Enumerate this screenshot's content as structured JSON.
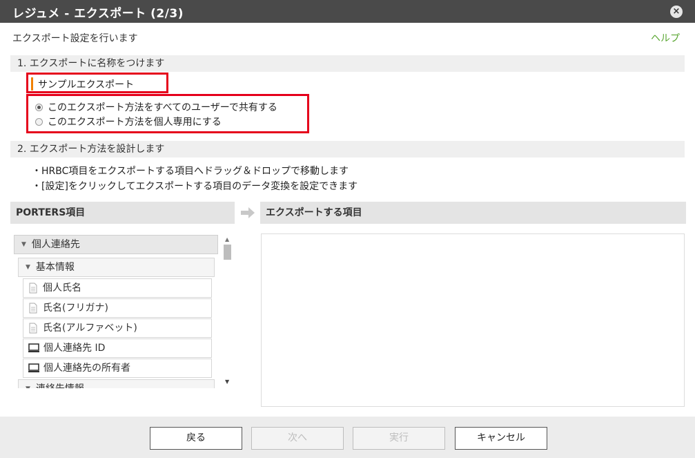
{
  "window": {
    "title": "レジュメ - エクスポート (2/3)",
    "close_glyph": "×"
  },
  "subtitle": "エクスポート設定を行います",
  "help_link": "ヘルプ",
  "section1": {
    "label": "1.  エクスポートに名称をつけます",
    "name_value": "サンプルエクスポート"
  },
  "share_options": [
    {
      "label": "このエクスポート方法をすべてのユーザーで共有する",
      "selected": true
    },
    {
      "label": "このエクスポート方法を個人専用にする",
      "selected": false
    }
  ],
  "section2": {
    "label": "2.  エクスポート方法を設計します",
    "instructions": [
      "・HRBC項目をエクスポートする項目へドラッグ＆ドロップで移動します",
      "・[設定]をクリックしてエクスポートする項目のデータ変換を設定できます"
    ]
  },
  "left_panel": {
    "header": "PORTERS項目",
    "tree": [
      {
        "label": "個人連絡先",
        "level": 1,
        "icon": "triangle-down-icon"
      },
      {
        "label": "基本情報",
        "level": 2,
        "icon": "triangle-down-icon"
      },
      {
        "label": "個人氏名",
        "level": 3,
        "icon": "document-icon"
      },
      {
        "label": "氏名(フリガナ)",
        "level": 3,
        "icon": "document-icon"
      },
      {
        "label": "氏名(アルファベット)",
        "level": 3,
        "icon": "document-icon"
      },
      {
        "label": "個人連絡先 ID",
        "level": 3,
        "icon": "computer-icon"
      },
      {
        "label": "個人連絡先の所有者",
        "level": 3,
        "icon": "computer-icon"
      },
      {
        "label": "連絡先情報",
        "level": 2,
        "icon": "triangle-down-icon"
      }
    ]
  },
  "right_panel": {
    "header": "エクスポートする項目"
  },
  "buttons": {
    "back": {
      "label": "戻る",
      "enabled": true
    },
    "next": {
      "label": "次へ",
      "enabled": false
    },
    "run": {
      "label": "実行",
      "enabled": false
    },
    "cancel": {
      "label": "キャンセル",
      "enabled": true
    }
  },
  "colors": {
    "accent_help": "#5aa632",
    "highlight_red": "#e5001b",
    "title_bar": "#4a4a4a"
  }
}
